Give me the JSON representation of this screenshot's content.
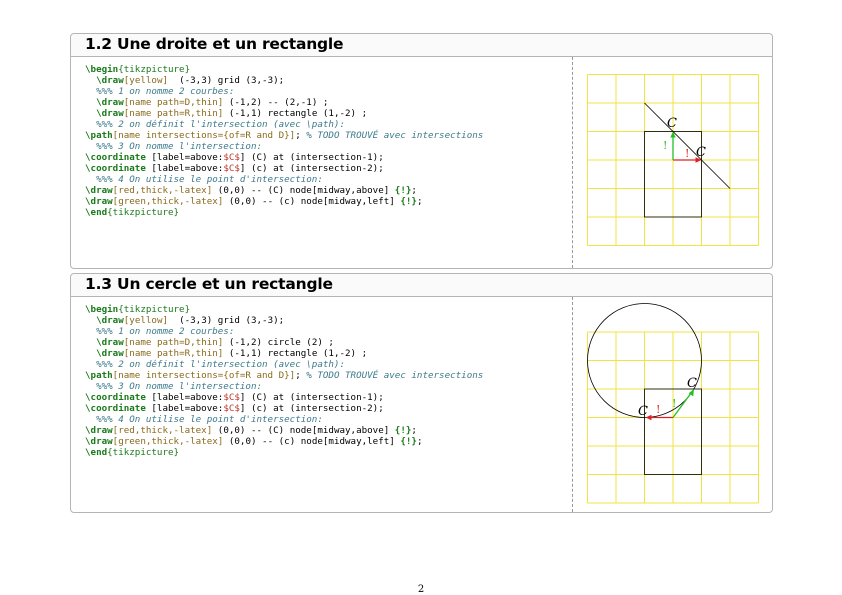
{
  "sections": [
    {
      "title": "1.2 Une droite et un rectangle",
      "code": [
        [
          [
            "kw",
            "\\begin"
          ],
          [
            "env",
            "{tikzpicture}"
          ]
        ],
        [
          [
            "",
            "  "
          ],
          [
            "kw",
            "\\draw"
          ],
          [
            "opt",
            "[yellow]"
          ],
          [
            "",
            "  (-3,3) grid (3,-3);"
          ]
        ],
        [
          [
            "cm",
            "  %%% 1 on nomme 2 courbes:"
          ]
        ],
        [
          [
            "",
            "  "
          ],
          [
            "kw",
            "\\draw"
          ],
          [
            "opt",
            "[name path=D,thin]"
          ],
          [
            "",
            " (-1,2) -- (2,-1) ;"
          ]
        ],
        [
          [
            "",
            "  "
          ],
          [
            "kw",
            "\\draw"
          ],
          [
            "opt",
            "[name path=R,thin]"
          ],
          [
            "",
            " (-1,1) rectangle (1,-2) ;"
          ]
        ],
        [
          [
            "cm",
            "  %%% 2 on définit l'intersection (avec \\path):"
          ]
        ],
        [
          [
            "kw",
            "\\path"
          ],
          [
            "opt",
            "[name intersections={of=R and D}]"
          ],
          [
            "",
            ";"
          ],
          [
            "cm",
            " % TODO TROUVÉ avec intersections"
          ]
        ],
        [
          [
            "cm",
            "  %%% 3 On nomme l'intersection:"
          ]
        ],
        [
          [
            "kw",
            "\\coordinate"
          ],
          [
            "",
            " [label=above:"
          ],
          [
            "math",
            "$C$"
          ],
          [
            "",
            "] (C) at (intersection-1);"
          ]
        ],
        [
          [
            "kw",
            "\\coordinate"
          ],
          [
            "",
            " [label=above:"
          ],
          [
            "math",
            "$C$"
          ],
          [
            "",
            "] (c) at (intersection-2);"
          ]
        ],
        [
          [
            "cm",
            "  %%% 4 On utilise le point d'intersection:"
          ]
        ],
        [
          [
            "kw",
            "\\draw"
          ],
          [
            "opt",
            "[red,thick,-latex]"
          ],
          [
            "",
            " (0,0) -- (C) node[midway,above] "
          ],
          [
            "kw",
            "{!}"
          ],
          [
            "",
            ";"
          ]
        ],
        [
          [
            "kw",
            "\\draw"
          ],
          [
            "opt",
            "[green,thick,-latex]"
          ],
          [
            "",
            " (0,0) -- (c) node[midway,left] "
          ],
          [
            "kw",
            "{!}"
          ],
          [
            "",
            ";"
          ]
        ],
        [
          [
            "kw",
            "\\end"
          ],
          [
            "env",
            "{tikzpicture}"
          ]
        ]
      ],
      "figure": {
        "label_c_upper": "C",
        "label_c_lower": "C",
        "bang_red": "!",
        "bang_green": "!"
      }
    },
    {
      "title": "1.3 Un cercle et un rectangle",
      "code": [
        [
          [
            "kw",
            "\\begin"
          ],
          [
            "env",
            "{tikzpicture}"
          ]
        ],
        [
          [
            "",
            "  "
          ],
          [
            "kw",
            "\\draw"
          ],
          [
            "opt",
            "[yellow]"
          ],
          [
            "",
            "  (-3,3) grid (3,-3);"
          ]
        ],
        [
          [
            "cm",
            "  %%% 1 on nomme 2 courbes:"
          ]
        ],
        [
          [
            "",
            "  "
          ],
          [
            "kw",
            "\\draw"
          ],
          [
            "opt",
            "[name path=D,thin]"
          ],
          [
            "",
            " (-1,2) circle (2) ;"
          ]
        ],
        [
          [
            "",
            "  "
          ],
          [
            "kw",
            "\\draw"
          ],
          [
            "opt",
            "[name path=R,thin]"
          ],
          [
            "",
            " (-1,1) rectangle (1,-2) ;"
          ]
        ],
        [
          [
            "cm",
            "  %%% 2 on définit l'intersection (avec \\path):"
          ]
        ],
        [
          [
            "kw",
            "\\path"
          ],
          [
            "opt",
            "[name intersections={of=R and D}]"
          ],
          [
            "",
            ";"
          ],
          [
            "cm",
            " % TODO TROUVÉ avec intersections"
          ]
        ],
        [
          [
            "cm",
            "  %%% 3 On nomme l'intersection:"
          ]
        ],
        [
          [
            "kw",
            "\\coordinate"
          ],
          [
            "",
            " [label=above:"
          ],
          [
            "math",
            "$C$"
          ],
          [
            "",
            "] (C) at (intersection-1);"
          ]
        ],
        [
          [
            "kw",
            "\\coordinate"
          ],
          [
            "",
            " [label=above:"
          ],
          [
            "math",
            "$C$"
          ],
          [
            "",
            "] (c) at (intersection-2);"
          ]
        ],
        [
          [
            "cm",
            "  %%% 4 On utilise le point d'intersection:"
          ]
        ],
        [
          [
            "kw",
            "\\draw"
          ],
          [
            "opt",
            "[red,thick,-latex]"
          ],
          [
            "",
            " (0,0) -- (C) node[midway,above] "
          ],
          [
            "kw",
            "{!}"
          ],
          [
            "",
            ";"
          ]
        ],
        [
          [
            "kw",
            "\\draw"
          ],
          [
            "opt",
            "[green,thick,-latex]"
          ],
          [
            "",
            " (0,0) -- (c) node[midway,left] "
          ],
          [
            "kw",
            "{!}"
          ],
          [
            "",
            ";"
          ]
        ],
        [
          [
            "kw",
            "\\end"
          ],
          [
            "env",
            "{tikzpicture}"
          ]
        ]
      ],
      "figure": {
        "label_c_upper": "C",
        "label_c_lower": "C",
        "bang_red": "!",
        "bang_green": "!"
      }
    }
  ],
  "page_number": "2",
  "colors": {
    "grid": "#f0e442",
    "red_arrow": "#e02020",
    "green_arrow": "#22c022",
    "keyword": "#1a7a1a",
    "comment": "#3d7a8c",
    "option": "#8a6a1c"
  }
}
